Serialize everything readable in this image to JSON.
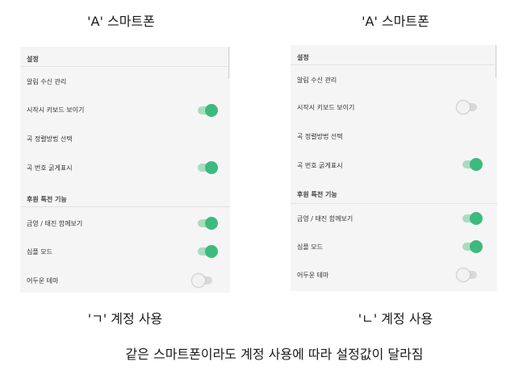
{
  "left": {
    "title": "'A' 스마트폰",
    "caption": "'ㄱ' 계정 사용",
    "settings_header": "설정",
    "items": [
      {
        "label": "알림 수신 관리",
        "toggle": null
      },
      {
        "label": "시작시 키보드 보이기",
        "toggle": true
      },
      {
        "label": "곡 정렬방법 선택",
        "toggle": null
      },
      {
        "label": "곡 번호 굵게표시",
        "toggle": true
      }
    ],
    "section2_header": "후원 특전 기능",
    "items2": [
      {
        "label": "금영 / 태진 함께보기",
        "toggle": true
      },
      {
        "label": "심플 모드",
        "toggle": true
      },
      {
        "label": "어두운 테마",
        "toggle": false
      }
    ]
  },
  "right": {
    "title": "'A' 스마트폰",
    "caption": "'ㄴ' 계정 사용",
    "settings_header": "설정",
    "items": [
      {
        "label": "알림 수신 관리",
        "toggle": null
      },
      {
        "label": "시작시 키보드 보이기",
        "toggle": false
      },
      {
        "label": "곡 정렬방법 선택",
        "toggle": null
      },
      {
        "label": "곡 번호 굵게표시",
        "toggle": true
      }
    ],
    "section2_header": "후원 특전 기능",
    "items2": [
      {
        "label": "금영 / 태진 함께보기",
        "toggle": true
      },
      {
        "label": "심플 모드",
        "toggle": true
      },
      {
        "label": "어두운 테마",
        "toggle": false
      }
    ]
  },
  "footer": "같은 스마트폰이라도 계정 사용에 따라 설정값이 달라짐"
}
